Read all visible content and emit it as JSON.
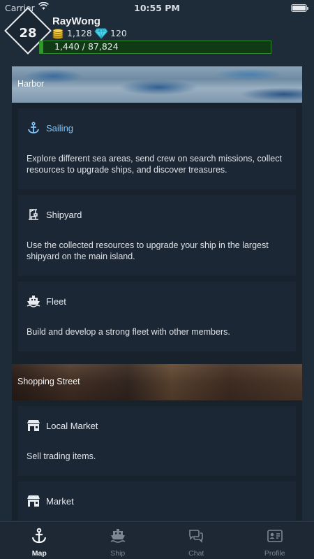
{
  "status_bar": {
    "carrier": "Carrier",
    "time": "10:55 PM"
  },
  "player": {
    "level": "28",
    "name": "RayWong",
    "coins": "1,128",
    "gems": "120",
    "xp_text": "1,440 / 87,824",
    "xp_progress": 0.016
  },
  "colors": {
    "accent": "#7cc7ff",
    "xp_fill": "#2e9a28",
    "background": "#1e2b38"
  },
  "sections": [
    {
      "banner": "Harbor",
      "cards": [
        {
          "icon": "anchor-icon",
          "title": "Sailing",
          "description": "Explore different sea areas, send crew on search missions, collect resources to upgrade ships, and discover treasures."
        },
        {
          "icon": "shipyard-crane-icon",
          "title": "Shipyard",
          "description": "Use the collected resources to upgrade your ship in the largest shipyard on the main island."
        },
        {
          "icon": "ship-icon",
          "title": "Fleet",
          "description": "Build and develop a strong fleet with other members."
        }
      ]
    },
    {
      "banner": "Shopping Street",
      "cards": [
        {
          "icon": "store-icon",
          "title": "Local Market",
          "description": "Sell trading items."
        },
        {
          "icon": "store-icon",
          "title": "Market",
          "description": ""
        }
      ]
    }
  ],
  "tabs": [
    {
      "icon": "anchor-icon",
      "label": "Map",
      "active": true
    },
    {
      "icon": "ship-icon",
      "label": "Ship",
      "active": false
    },
    {
      "icon": "chat-icon",
      "label": "Chat",
      "active": false
    },
    {
      "icon": "profile-card-icon",
      "label": "Profile",
      "active": false
    }
  ]
}
